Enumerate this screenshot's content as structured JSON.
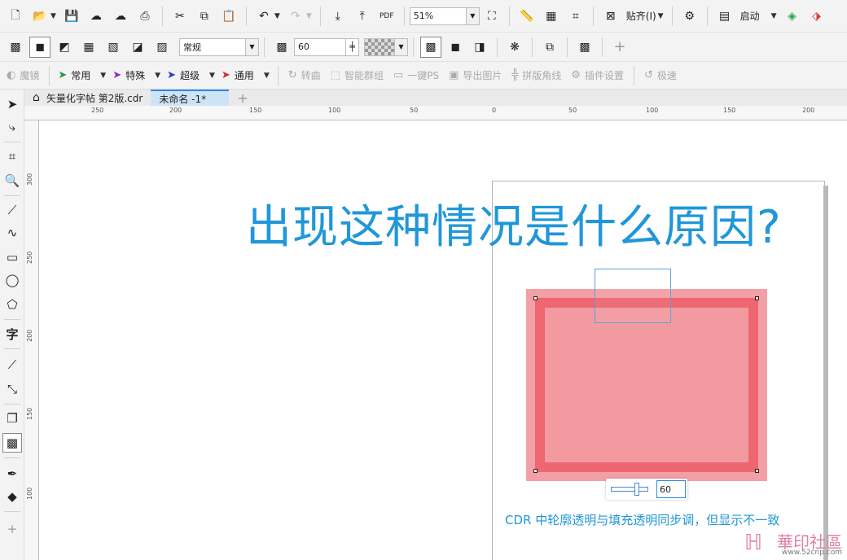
{
  "toolbar1": {
    "zoom_value": "51%",
    "snap_label": "贴齐(I)",
    "launch_label": "启动"
  },
  "toolbar2": {
    "merge_mode": "常规",
    "transparency_value": "60"
  },
  "toolbar3": {
    "items": [
      {
        "label": "魔镜",
        "enabled": false
      },
      {
        "label": "常用",
        "enabled": true
      },
      {
        "label": "特殊",
        "enabled": true
      },
      {
        "label": "超级",
        "enabled": true
      },
      {
        "label": "通用",
        "enabled": true
      },
      {
        "label": "转曲",
        "enabled": false
      },
      {
        "label": "智能群组",
        "enabled": false
      },
      {
        "label": "一键PS",
        "enabled": false
      },
      {
        "label": "导出图片",
        "enabled": false
      },
      {
        "label": "拼版角线",
        "enabled": false
      },
      {
        "label": "插件设置",
        "enabled": false
      },
      {
        "label": "极速",
        "enabled": false
      }
    ]
  },
  "tabs": [
    {
      "label": "矢量化字帖 第2版.cdr",
      "active": false
    },
    {
      "label": "未命名 -1*",
      "active": true
    }
  ],
  "ruler": {
    "horizontal": [
      "250",
      "200",
      "150",
      "100",
      "50",
      "0",
      "50",
      "100",
      "150",
      "200"
    ],
    "vertical": [
      "300",
      "250",
      "200",
      "150",
      "100"
    ]
  },
  "canvas": {
    "headline": "出现这种情况是什么原因?",
    "slider_value": "60",
    "caption": "CDR 中轮廓透明与填充透明同步调，但显示不一致",
    "colors": {
      "headline": "#2097d8",
      "fill": "#f29aa0",
      "outline": "#ee6670"
    }
  },
  "watermark": {
    "text": "華印社區",
    "url": "www.52cnp.com"
  }
}
